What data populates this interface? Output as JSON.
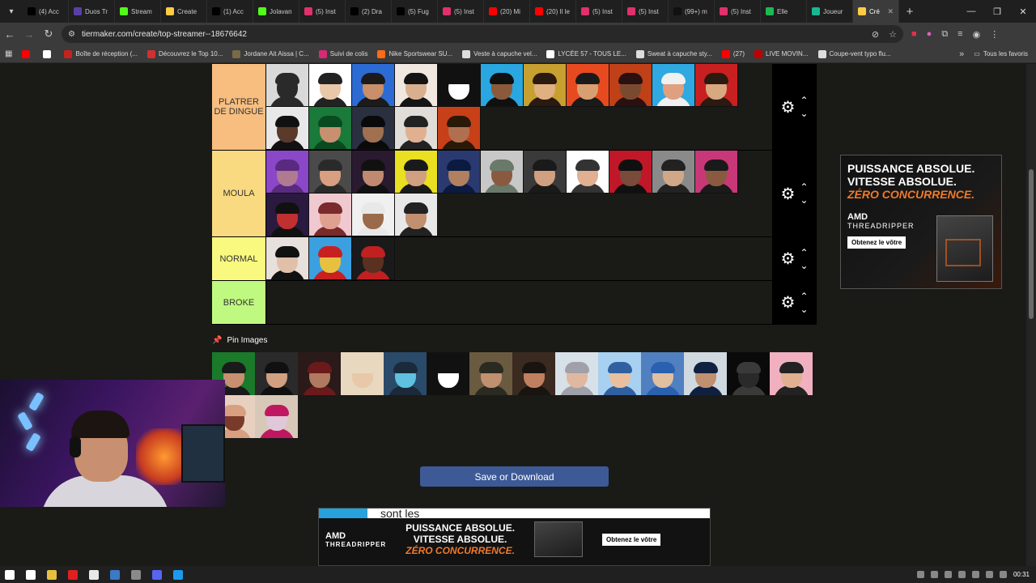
{
  "browser": {
    "tabs": [
      {
        "label": "(4) Acc",
        "color": "#000000",
        "active": false
      },
      {
        "label": "Duos Tr",
        "color": "#5b3fa8",
        "active": false
      },
      {
        "label": "Stream",
        "color": "#53fc18",
        "active": false
      },
      {
        "label": "Create",
        "color": "#ffcc44",
        "active": false
      },
      {
        "label": "(1) Acc",
        "color": "#000000",
        "active": false
      },
      {
        "label": "Jolavan",
        "color": "#53fc18",
        "active": false
      },
      {
        "label": "(5) Inst",
        "color": "#e1306c",
        "active": false
      },
      {
        "label": "(2) Dra",
        "color": "#000000",
        "active": false
      },
      {
        "label": "(5) Fug",
        "color": "#000000",
        "active": false
      },
      {
        "label": "(5) Inst",
        "color": "#e1306c",
        "active": false
      },
      {
        "label": "(20) Mi",
        "color": "#ff0000",
        "active": false
      },
      {
        "label": "(20) Il le",
        "color": "#ff0000",
        "active": false
      },
      {
        "label": "(5) Inst",
        "color": "#e1306c",
        "active": false
      },
      {
        "label": "(5) Inst",
        "color": "#e1306c",
        "active": false
      },
      {
        "label": "(99+) m",
        "color": "#111111",
        "active": false
      },
      {
        "label": "(5) Inst",
        "color": "#e1306c",
        "active": false
      },
      {
        "label": "Elle",
        "color": "#1db954",
        "active": false
      },
      {
        "label": "Joueur",
        "color": "#17b890",
        "active": false
      },
      {
        "label": "Cré",
        "color": "#ffcc44",
        "active": true
      }
    ],
    "url": "tiermaker.com/create/top-streamer--18676642",
    "bookmarks": [
      {
        "label": "",
        "color": "#ff0000"
      },
      {
        "label": "",
        "color": "#ffffff"
      },
      {
        "label": "Boîte de réception (...",
        "color": "#c5221f"
      },
      {
        "label": "Découvrez le Top 10...",
        "color": "#d13030"
      },
      {
        "label": "Jordane Ait Aissa | C...",
        "color": "#7a6a4a"
      },
      {
        "label": "Suivi de colis",
        "color": "#d62976"
      },
      {
        "label": "Nike Sportswear SU...",
        "color": "#ff6b1a"
      },
      {
        "label": "Veste à capuche vel...",
        "color": "#dddddd"
      },
      {
        "label": "LYCÉE 57 - TOUS LE...",
        "color": "#ffffff"
      },
      {
        "label": "Sweat à capuche sty...",
        "color": "#dddddd"
      },
      {
        "label": "(27)",
        "color": "#ff0000"
      },
      {
        "label": "LIVE MOVIN...",
        "color": "#c00000"
      },
      {
        "label": "Coupe-vent typo flu...",
        "color": "#dddddd"
      }
    ],
    "all_bookmarks_label": "Tous les favoris"
  },
  "tiers": [
    {
      "label": "PLATRER DE DINGUE",
      "color": "#f7be80",
      "height": 106,
      "items": [
        [
          "#d9d9d9",
          "#2a2a2a",
          "#2a2a2a"
        ],
        [
          "#ffffff",
          "#e8c8a8",
          "#222222"
        ],
        [
          "#2d6bd4",
          "#c98e6a",
          "#1b1b1b"
        ],
        [
          "#f0e8e0",
          "#d8b090",
          "#141414"
        ],
        [
          "#111111",
          "#ffffff",
          "#111111"
        ],
        [
          "#2aa6e0",
          "#8a5a3a",
          "#101010"
        ],
        [
          "#c8a030",
          "#e0b080",
          "#2a1a10"
        ],
        [
          "#e84a20",
          "#d8a070",
          "#1a1a1a"
        ],
        [
          "#c04018",
          "#7a4a30",
          "#2a1010"
        ],
        [
          "#30a8e0",
          "#e0a080",
          "#f0f0f0"
        ],
        [
          "#c82020",
          "#d8a880",
          "#2a1a10"
        ],
        [
          "#e8e8e8",
          "#5a3a2a",
          "#111111"
        ],
        [
          "#1a7a3a",
          "#c89070",
          "#0a4a20"
        ],
        [
          "#2a3040",
          "#a07050",
          "#0a0a0a"
        ],
        [
          "#e0dcd8",
          "#e0b090",
          "#222222"
        ],
        [
          "#c84018",
          "#b07050",
          "#2a1808"
        ]
      ]
    },
    {
      "label": "MOULA",
      "color": "#f9da80",
      "height": 107,
      "items": [
        [
          "#8a48c8",
          "#b07a90",
          "#5a2a80"
        ],
        [
          "#4a4a4a",
          "#d8a080",
          "#2a2a2a"
        ],
        [
          "#2a1a30",
          "#c08a70",
          "#111111"
        ],
        [
          "#e8e020",
          "#d0a080",
          "#1a1a1a"
        ],
        [
          "#2a3a70",
          "#b08060",
          "#0a1a40"
        ],
        [
          "#c8c8c8",
          "#8a5a40",
          "#6a7a6a"
        ],
        [
          "#3a3a3a",
          "#d0a080",
          "#1a1a1a"
        ],
        [
          "#ffffff",
          "#e0b090",
          "#333333"
        ],
        [
          "#c01828",
          "#7a4a3a",
          "#101010"
        ],
        [
          "#8a8a8a",
          "#d0a888",
          "#222222"
        ],
        [
          "#c83878",
          "#8a5a40",
          "#1a1a1a"
        ],
        [
          "#2a1a40",
          "#c03030",
          "#111111"
        ],
        [
          "#f0c8d0",
          "#e0a090",
          "#7a2a2a"
        ],
        [
          "#f0f0f0",
          "#9a6a4a",
          "#e8e8e8"
        ],
        [
          "#e8e8e8",
          "#c09070",
          "#222222"
        ]
      ]
    },
    {
      "label": "NORMAL",
      "color": "#f9f980",
      "height": 54,
      "items": [
        [
          "#e8e0dc",
          "#e0c0a8",
          "#111111"
        ],
        [
          "#3aa0e0",
          "#e8c040",
          "#c82020"
        ],
        [
          "#1a1a1a",
          "#5a3020",
          "#c02020"
        ]
      ]
    },
    {
      "label": "BROKE",
      "color": "#c0f980",
      "height": 54,
      "items": []
    }
  ],
  "pin_label": "Pin Images",
  "pool": [
    [
      "#1a7a2a",
      "#c89070",
      "#1a1a1a"
    ],
    [
      "#2a2a2a",
      "#d0a080",
      "#101010"
    ],
    [
      "#2a1a1a",
      "#b07a60",
      "#6a1a1a"
    ],
    [
      "#e8d8c0",
      "#e8c8a8",
      "#e8d8c0"
    ],
    [
      "#2a4a6a",
      "#60c0e0",
      "#1a2a3a"
    ],
    [
      "#111111",
      "#ffffff",
      "#111111"
    ],
    [
      "#6a5a40",
      "#c09070",
      "#2a2a20"
    ],
    [
      "#3a2a20",
      "#c08060",
      "#1a1410"
    ],
    [
      "#d8e0e8",
      "#e0b8a0",
      "#a0a0a8"
    ],
    [
      "#a8d0f0",
      "#e8c0a0",
      "#3060a0"
    ],
    [
      "#5080c0",
      "#e0c0a0",
      "#2a60b0"
    ],
    [
      "#d0d8e0",
      "#c09070",
      "#102040"
    ],
    [
      "#0a0a0a",
      "#2a2a2a",
      "#3a3a3a"
    ],
    [
      "#f0b0c0",
      "#e0b090",
      "#222222"
    ],
    [
      "#e8d0c0",
      "#7a3a2a",
      "#d8a080"
    ],
    [
      "#d8c8b8",
      "#e0c8d8",
      "#c01860"
    ]
  ],
  "save_button": "Save or Download",
  "ads": {
    "line1": "PUISSANCE ABSOLUE.",
    "line2": "VITESSE ABSOLUE.",
    "line3": "ZÉRO CONCURRENCE.",
    "brand": "AMD",
    "product": "THREADRIPPER",
    "cta": "Obtenez le vôtre",
    "overlay_text": "sont les"
  },
  "taskbar": {
    "time": "00:31",
    "icons": [
      "#ffffff",
      "#ffffff",
      "#e8c040",
      "#e02020",
      "#e8e8e8",
      "#3a7ac8",
      "#8a8a8a",
      "#5865f2",
      "#1b9aee"
    ]
  }
}
